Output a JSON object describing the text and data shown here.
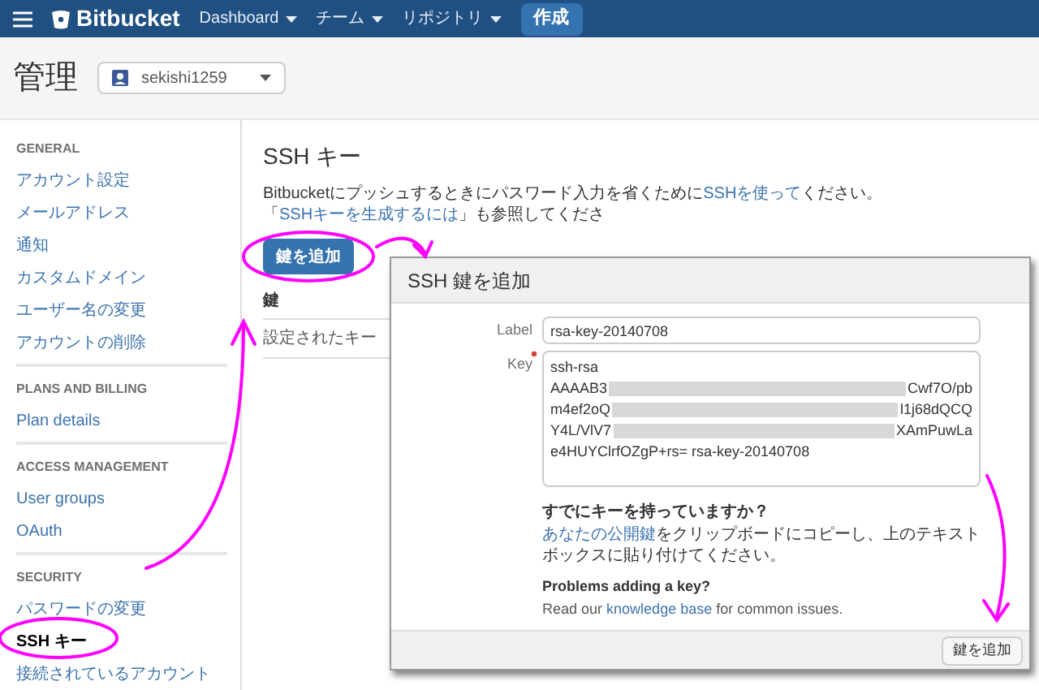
{
  "topbar": {
    "logo": "Bitbucket",
    "nav": [
      {
        "label": "Dashboard"
      },
      {
        "label": "チーム"
      },
      {
        "label": "リポジトリ"
      }
    ],
    "create_button": "作成"
  },
  "header": {
    "title": "管理",
    "account": "sekishi1259"
  },
  "sidebar": {
    "sections": [
      {
        "heading": "GENERAL",
        "items": [
          {
            "label": "アカウント設定",
            "selected": false
          },
          {
            "label": "メールアドレス",
            "selected": false
          },
          {
            "label": "通知",
            "selected": false
          },
          {
            "label": "カスタムドメイン",
            "selected": false
          },
          {
            "label": "ユーザー名の変更",
            "selected": false
          },
          {
            "label": "アカウントの削除",
            "selected": false
          }
        ]
      },
      {
        "heading": "PLANS AND BILLING",
        "items": [
          {
            "label": "Plan details",
            "selected": false
          }
        ]
      },
      {
        "heading": "ACCESS MANAGEMENT",
        "items": [
          {
            "label": "User groups",
            "selected": false
          },
          {
            "label": "OAuth",
            "selected": false
          }
        ]
      },
      {
        "heading": "SECURITY",
        "items": [
          {
            "label": "パスワードの変更",
            "selected": false
          },
          {
            "label": "SSH キー",
            "selected": true
          },
          {
            "label": "接続されているアカウント",
            "selected": false
          }
        ]
      }
    ]
  },
  "main": {
    "title": "SSH キー",
    "description": [
      {
        "kind": "text",
        "text": "Bitbucketにプッシュするときにパスワード入力を省くために"
      },
      {
        "kind": "link",
        "text": "SSHを使って"
      },
      {
        "kind": "text",
        "text": "ください。「"
      },
      {
        "kind": "link",
        "text": "SSHキーを生成するには"
      },
      {
        "kind": "text",
        "text": "」も参照してくださ"
      }
    ],
    "add_button": "鍵を追加",
    "table": {
      "columns": [
        "鍵"
      ],
      "rows": [
        "設定されたキー"
      ]
    }
  },
  "dialog": {
    "title": "SSH 鍵を追加",
    "label_field": {
      "label": "Label",
      "value": "rsa-key-20140708"
    },
    "key_field": {
      "label": "Key",
      "required": true,
      "lines": [
        {
          "kind": "plain",
          "text": "ssh-rsa"
        },
        {
          "kind": "redacted",
          "start": "AAAAB3",
          "end": "Cwf7O/pb"
        },
        {
          "kind": "redacted",
          "start": "m4ef2oQ",
          "end": "l1j68dQCQ"
        },
        {
          "kind": "redacted",
          "start": "Y4L/VlV7",
          "end": "XAmPuwLa"
        },
        {
          "kind": "plain",
          "text": "e4HUYClrfOZgP+rs= rsa-key-20140708"
        }
      ]
    },
    "help": {
      "heading": "すでにキーを持っていますか？",
      "link": "あなたの公開鍵",
      "text": "をクリップボードにコピーし、上のテキストボックスに貼り付けてください。"
    },
    "problems": {
      "heading": "Problems adding a key?",
      "before": "Read our",
      "link": "knowledge base",
      "after": "for common issues."
    },
    "submit_button": "鍵を追加"
  }
}
